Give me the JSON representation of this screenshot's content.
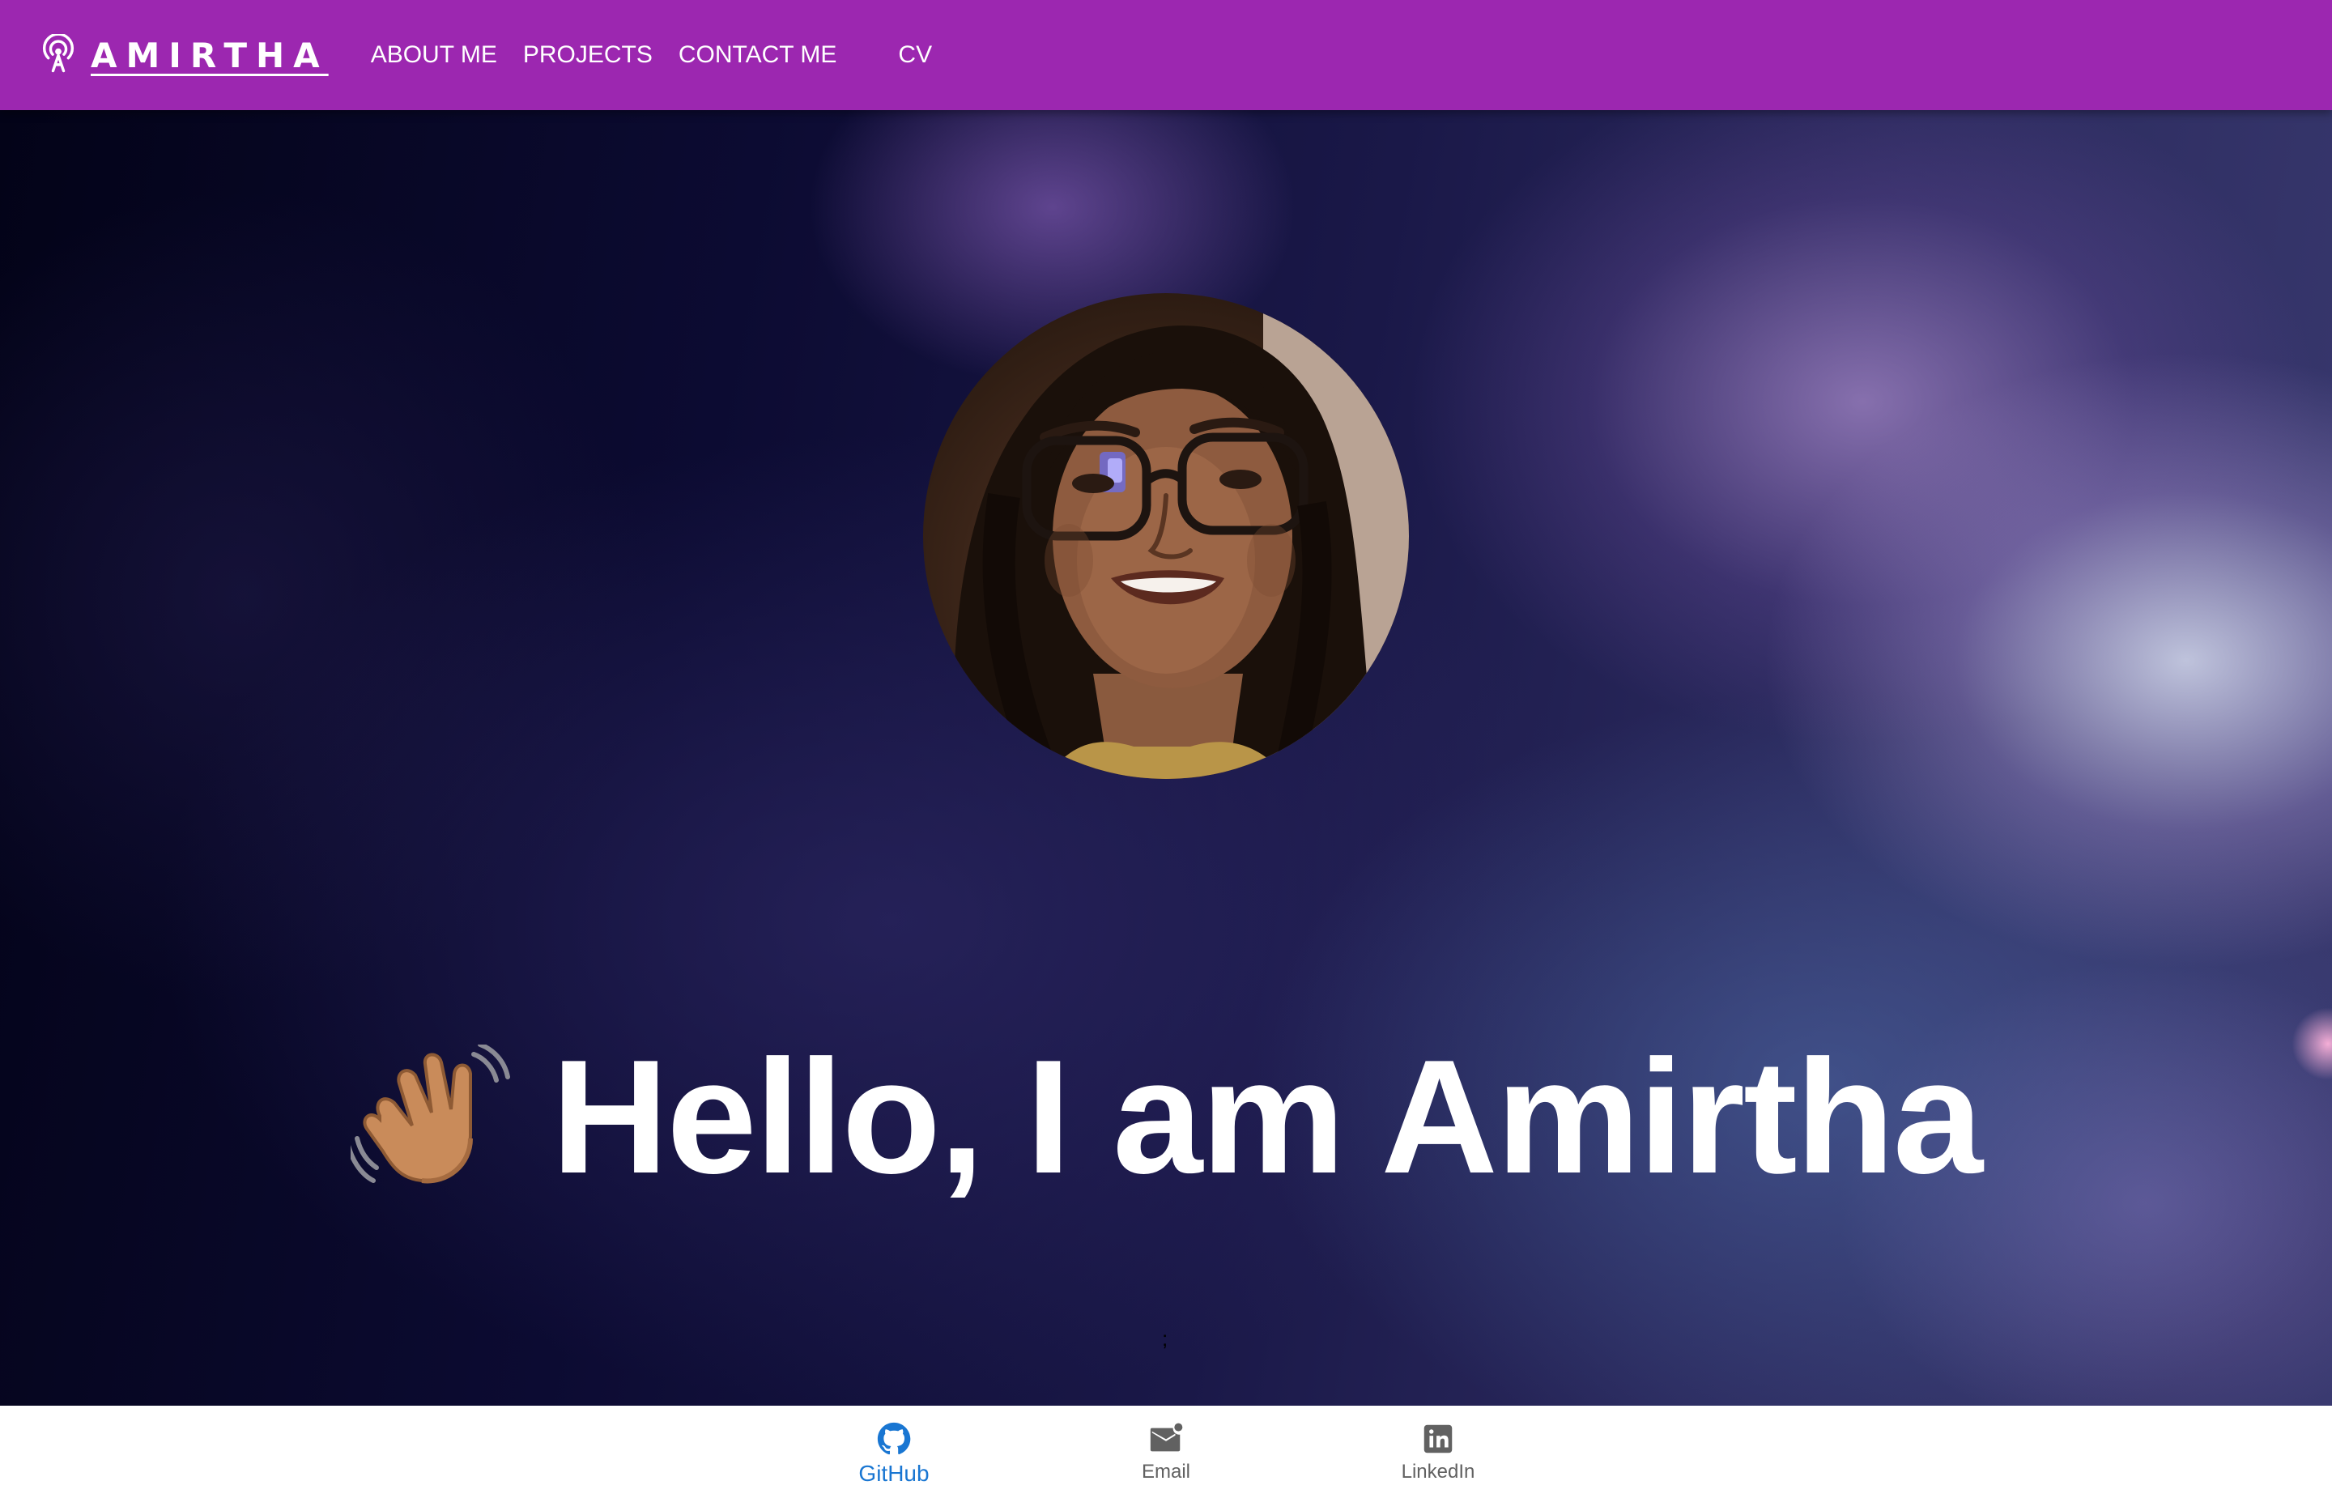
{
  "header": {
    "brand": "AMIRTHA",
    "brand_icon": "podcast-antenna-icon",
    "nav": [
      "ABOUT ME",
      "PROJECTS",
      "CONTACT ME",
      "CV"
    ],
    "background_color": "#9c27b0"
  },
  "hero": {
    "avatar": "profile-photo",
    "emoji_icon": "waving-hand-icon",
    "heading": "Hello, I am Amirtha",
    "stray_text": ";"
  },
  "bottom_nav": {
    "active_color": "#1976d2",
    "inactive_color": "#616161",
    "items": [
      {
        "label": "GitHub",
        "icon": "github-icon",
        "active": true
      },
      {
        "label": "Email",
        "icon": "email-icon",
        "active": false
      },
      {
        "label": "LinkedIn",
        "icon": "linkedin-icon",
        "active": false
      }
    ]
  }
}
